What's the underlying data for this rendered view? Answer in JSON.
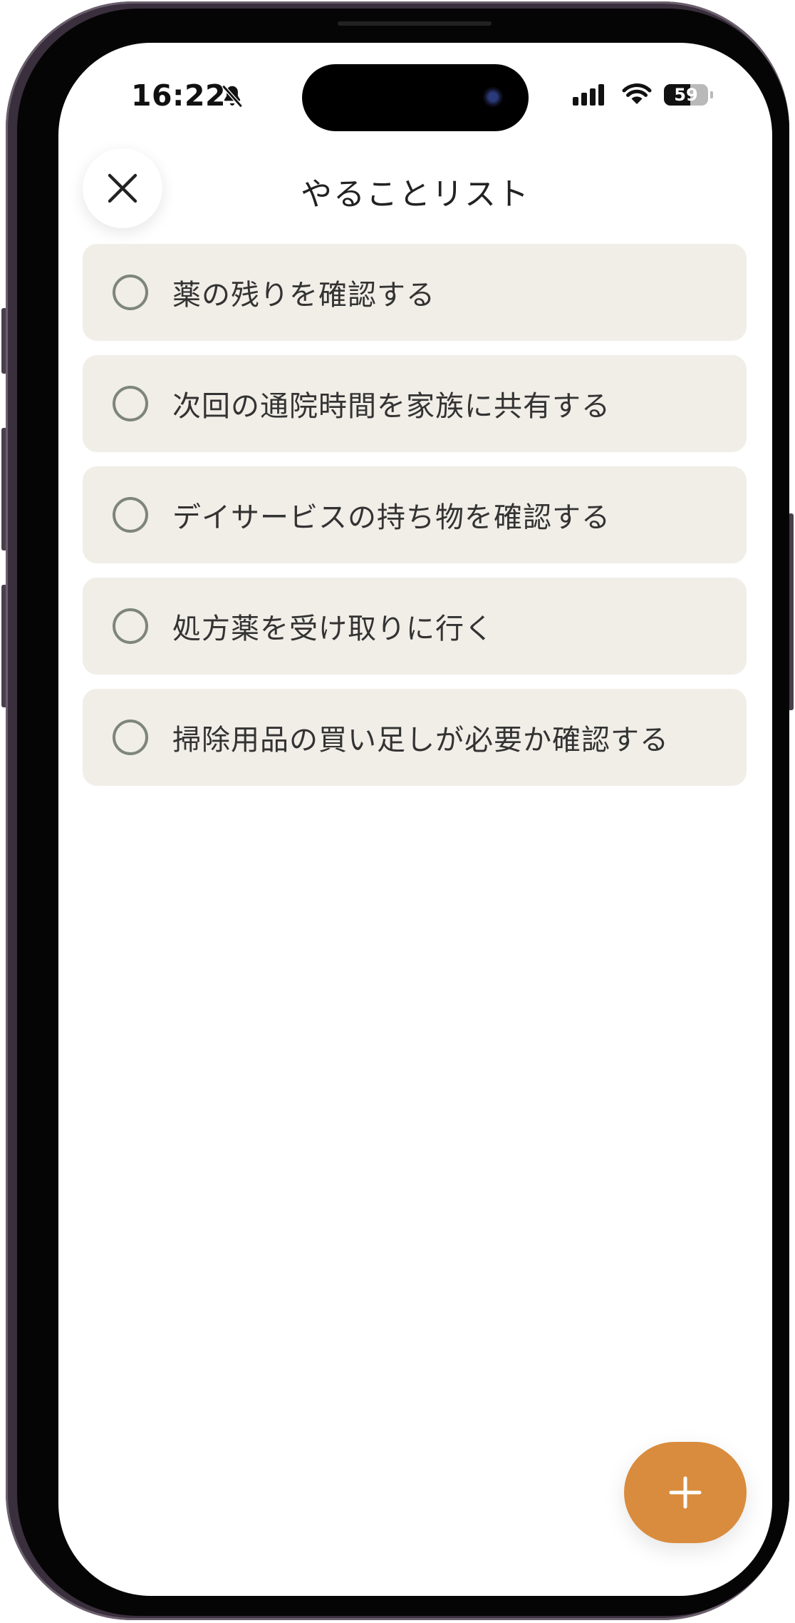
{
  "status_bar": {
    "time": "16:22",
    "silent_icon": "bell-slash-icon",
    "signal_icon": "cellular-signal-icon",
    "wifi_icon": "wifi-icon",
    "battery_level": "59",
    "battery_fraction": 0.59
  },
  "header": {
    "close_icon": "close-icon",
    "title": "やることリスト"
  },
  "tasks": [
    {
      "label": "薬の残りを確認する",
      "checked": false
    },
    {
      "label": "次回の通院時間を家族に共有する",
      "checked": false
    },
    {
      "label": "デイサービスの持ち物を確認する",
      "checked": false
    },
    {
      "label": "処方薬を受け取りに行く",
      "checked": false
    },
    {
      "label": "掃除用品の買い足しが必要か確認する",
      "checked": false
    }
  ],
  "fab": {
    "icon": "plus-icon"
  },
  "colors": {
    "accent": "#d98c3d",
    "task_background": "#f0eee7",
    "checkbox_border": "#7e857c",
    "text": "#333333"
  }
}
